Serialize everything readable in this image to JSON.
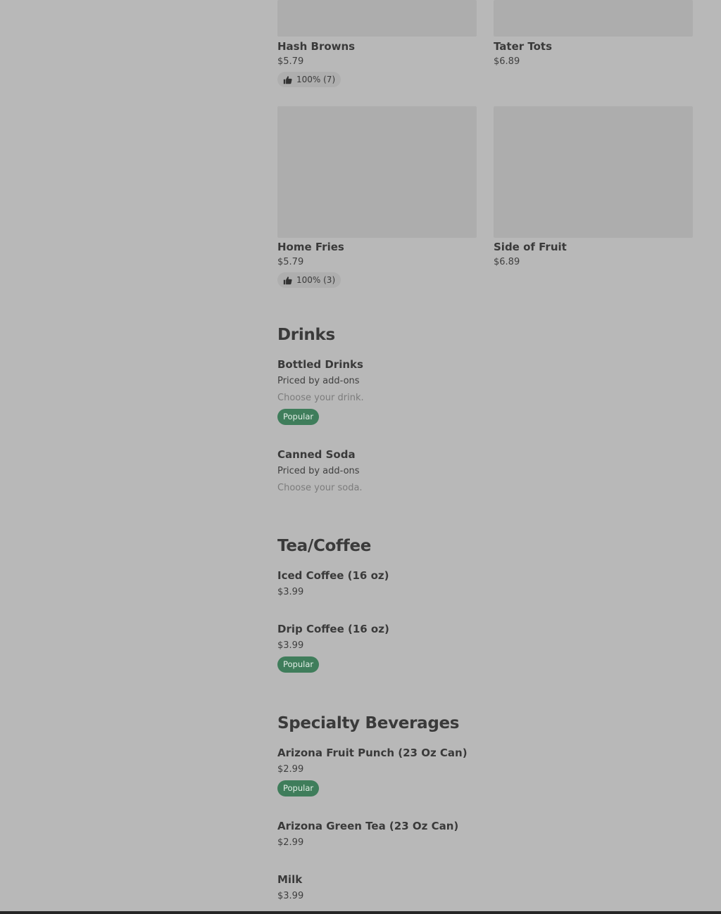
{
  "colors": {
    "page_background": "#b8b8b8",
    "placeholder_image": "#adadad",
    "popular_badge": "#3f7d5b",
    "rating_pill": "#aeaeae"
  },
  "grid_items": [
    {
      "name": "Hash Browns",
      "price": "$5.79",
      "rating": "100% (7)",
      "icon": "thumbs-up-icon"
    },
    {
      "name": "Tater Tots",
      "price": "$6.89",
      "rating": null
    },
    {
      "name": "Home Fries",
      "price": "$5.79",
      "rating": "100% (3)",
      "icon": "thumbs-up-icon"
    },
    {
      "name": "Side of Fruit",
      "price": "$6.89",
      "rating": null
    }
  ],
  "sections": [
    {
      "title": "Drinks",
      "items": [
        {
          "name": "Bottled Drinks",
          "price": "Priced by add-ons",
          "description": "Choose your drink.",
          "badge": "Popular"
        },
        {
          "name": "Canned Soda",
          "price": "Priced by add-ons",
          "description": "Choose your soda.",
          "badge": null
        }
      ]
    },
    {
      "title": "Tea/Coffee",
      "items": [
        {
          "name": "Iced Coffee (16 oz)",
          "price": "$3.99",
          "badge": null
        },
        {
          "name": "Drip Coffee (16 oz)",
          "price": "$3.99",
          "badge": "Popular"
        }
      ]
    },
    {
      "title": "Specialty Beverages",
      "items": [
        {
          "name": "Arizona Fruit Punch (23 Oz Can)",
          "price": "$2.99",
          "badge": "Popular"
        },
        {
          "name": "Arizona Green Tea (23 Oz Can)",
          "price": "$2.99",
          "badge": null
        },
        {
          "name": "Milk",
          "price": "$3.99",
          "badge": null
        }
      ]
    }
  ]
}
